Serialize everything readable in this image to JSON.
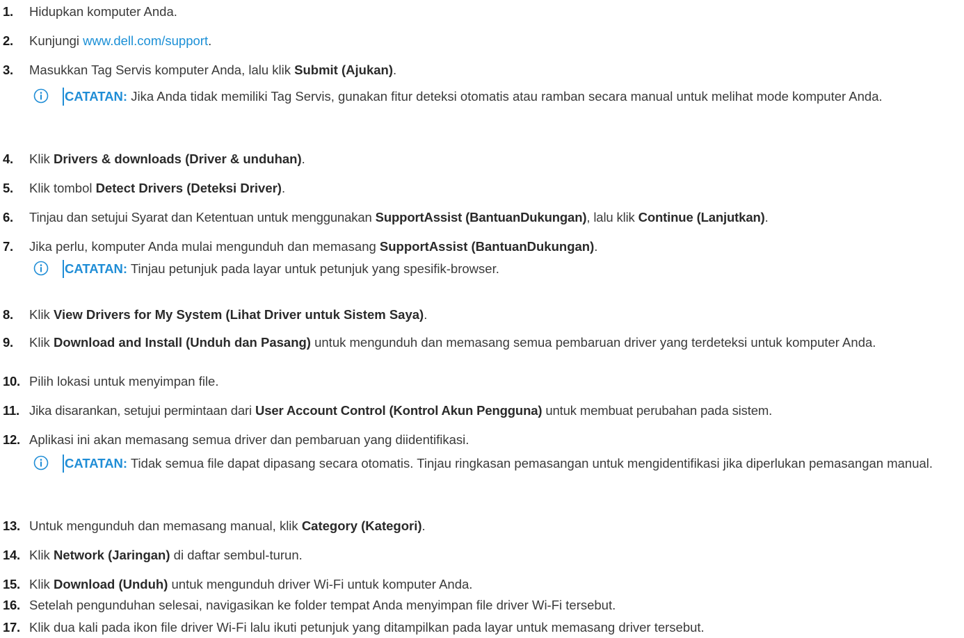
{
  "steps": [
    {
      "num": "1.",
      "parts": [
        {
          "t": "Hidupkan komputer Anda."
        }
      ]
    },
    {
      "num": "2.",
      "parts": [
        {
          "t": "Kunjungi "
        },
        {
          "t": "www.dell.com/support",
          "link": true
        },
        {
          "t": "."
        }
      ]
    },
    {
      "num": "3.",
      "parts": [
        {
          "t": "Masukkan Tag Servis komputer Anda, lalu klik "
        },
        {
          "t": "Submit (Ajukan)",
          "b": true
        },
        {
          "t": "."
        }
      ]
    },
    {
      "num": "4.",
      "parts": [
        {
          "t": "Klik "
        },
        {
          "t": "Drivers & downloads (Driver & unduhan)",
          "b": true
        },
        {
          "t": "."
        }
      ]
    },
    {
      "num": "5.",
      "parts": [
        {
          "t": "Klik tombol "
        },
        {
          "t": "Detect Drivers (Deteksi Driver)",
          "b": true
        },
        {
          "t": "."
        }
      ]
    },
    {
      "num": "6.",
      "parts": [
        {
          "t": "Tinjau dan setujui Syarat dan Ketentuan untuk menggunakan "
        },
        {
          "t": "SupportAssist (BantuanDukungan)",
          "b": true
        },
        {
          "t": ", lalu klik "
        },
        {
          "t": "Continue (Lanjutkan)",
          "b": true
        },
        {
          "t": "."
        }
      ]
    },
    {
      "num": "7.",
      "parts": [
        {
          "t": "Jika perlu, komputer Anda mulai mengunduh dan memasang "
        },
        {
          "t": "SupportAssist (BantuanDukungan)",
          "b": true
        },
        {
          "t": "."
        }
      ]
    },
    {
      "num": "8.",
      "parts": [
        {
          "t": "Klik "
        },
        {
          "t": "View Drivers for My System (Lihat Driver untuk Sistem Saya)",
          "b": true
        },
        {
          "t": "."
        }
      ]
    },
    {
      "num": "9.",
      "parts": [
        {
          "t": "Klik "
        },
        {
          "t": "Download and Install (Unduh dan Pasang)",
          "b": true
        },
        {
          "t": " untuk mengunduh dan memasang semua pembaruan driver yang terdeteksi untuk komputer Anda."
        }
      ]
    },
    {
      "num": "10.",
      "parts": [
        {
          "t": "Pilih lokasi untuk menyimpan file."
        }
      ]
    },
    {
      "num": "11.",
      "parts": [
        {
          "t": "Jika disarankan, setujui permintaan dari "
        },
        {
          "t": "User Account Control (Kontrol Akun Pengguna)",
          "b": true
        },
        {
          "t": " untuk membuat perubahan pada sistem."
        }
      ]
    },
    {
      "num": "12.",
      "parts": [
        {
          "t": "Aplikasi ini akan memasang semua driver dan pembaruan yang diidentifikasi."
        }
      ]
    },
    {
      "num": "13.",
      "parts": [
        {
          "t": "Untuk mengunduh dan memasang manual, klik "
        },
        {
          "t": "Category (Kategori)",
          "b": true
        },
        {
          "t": "."
        }
      ]
    },
    {
      "num": "14.",
      "parts": [
        {
          "t": "Klik "
        },
        {
          "t": "Network (Jaringan)",
          "b": true
        },
        {
          "t": " di daftar sembul-turun."
        }
      ]
    },
    {
      "num": "15.",
      "parts": [
        {
          "t": "Klik "
        },
        {
          "t": "Download (Unduh)",
          "b": true
        },
        {
          "t": " untuk mengunduh driver Wi-Fi untuk komputer Anda."
        }
      ]
    },
    {
      "num": "16.",
      "parts": [
        {
          "t": "Setelah pengunduhan selesai, navigasikan ke folder tempat Anda menyimpan file driver Wi-Fi tersebut."
        }
      ]
    },
    {
      "num": "17.",
      "parts": [
        {
          "t": "Klik dua kali pada ikon file driver Wi-Fi lalu ikuti petunjuk yang ditampilkan pada layar untuk memasang driver tersebut."
        }
      ]
    }
  ],
  "notes": [
    {
      "label": "CATATAN:",
      "text": " Jika Anda tidak memiliki Tag Servis, gunakan fitur deteksi otomatis atau ramban secara manual untuk melihat mode komputer Anda."
    },
    {
      "label": "CATATAN:",
      "text": " Tinjau petunjuk pada layar untuk petunjuk yang spesifik-browser."
    },
    {
      "label": "CATATAN:",
      "text": " Tidak semua file dapat dipasang secara otomatis. Tinjau ringkasan pemasangan untuk mengidentifikasi jika diperlukan pemasangan manual."
    }
  ],
  "colors": {
    "accent": "#1f8dd6",
    "link": "#1a8fd6"
  },
  "icons": {
    "note": "info-circle-icon"
  }
}
